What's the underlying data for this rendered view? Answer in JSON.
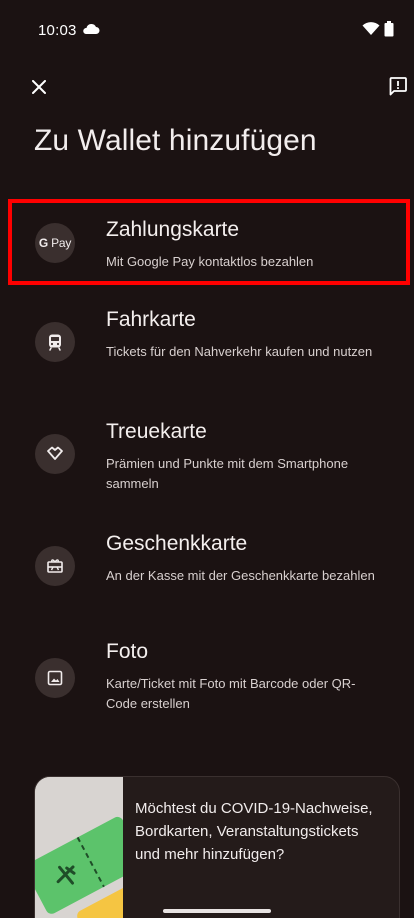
{
  "status_bar": {
    "time": "10:03",
    "cloud_icon": "cloud-icon",
    "wifi_icon": "wifi-icon",
    "battery_icon": "battery-icon"
  },
  "toolbar": {
    "close_icon": "close-icon",
    "feedback_icon": "feedback-icon"
  },
  "page": {
    "title": "Zu Wallet hinzufügen"
  },
  "options": [
    {
      "icon": "gpay-icon",
      "icon_text_g": "G",
      "icon_text_pay": "Pay",
      "title": "Zahlungskarte",
      "description": "Mit Google Pay kontaktlos bezahlen"
    },
    {
      "icon": "train-icon",
      "title": "Fahrkarte",
      "description": "Tickets für den Nahverkehr kaufen und nutzen"
    },
    {
      "icon": "heart-tag-icon",
      "title": "Treuekarte",
      "description": "Prämien und Punkte mit dem Smartphone sammeln"
    },
    {
      "icon": "gift-card-icon",
      "title": "Geschenkkarte",
      "description": "An der Kasse mit der Geschenkkarte bezahlen"
    },
    {
      "icon": "photo-icon",
      "title": "Foto",
      "description": "Karte/Ticket mit Foto mit Barcode oder QR-Code erstellen"
    }
  ],
  "promo": {
    "text": "Möchtest du COVID-19-Nachweise, Bordkarten, Veranstaltungstickets und mehr hinzufügen?"
  },
  "colors": {
    "background": "#1b1212",
    "highlight_border": "#ff0000",
    "icon_circle": "#3a2f2e"
  }
}
